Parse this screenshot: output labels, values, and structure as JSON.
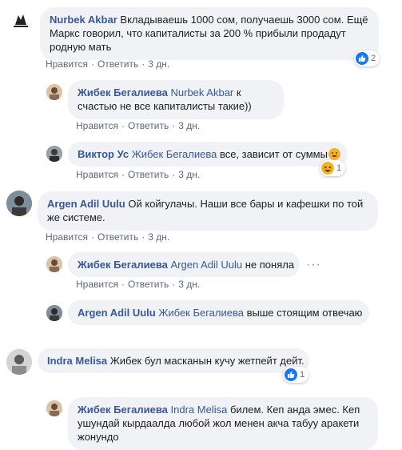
{
  "colors": {
    "author": "#385898",
    "bubble": "#f0f2f5",
    "meta": "#606770",
    "like_blue": "#1877f2",
    "haha_yellow": "#f7b125"
  },
  "labels": {
    "like": "Нравится",
    "reply": "Ответить",
    "sep": "·"
  },
  "comments": [
    {
      "author": "Nurbek Akbar",
      "text": "Вкладываешь 1000 сом, получаешь 3000 сом. Ещё Маркс говорил, что капиталисты за 200 % прибыли продадут родную мать",
      "time": "3 дн.",
      "reactions": {
        "icon": "like-icon",
        "count": "2"
      }
    },
    {
      "author": "Жибек Бегалиева",
      "mention": "Nurbek Akbar",
      "text": "к счастью не все капиталисты такие))",
      "time": "3 дн."
    },
    {
      "author": "Виктор Ус",
      "mention": "Жибек Бегалиева",
      "text": "все, зависит от суммы",
      "emoji": "grinning-sweat-emoji",
      "time": "3 дн.",
      "reactions": {
        "icon": "haha-icon",
        "count": "1"
      }
    },
    {
      "author": "Argen Adil Uulu",
      "text": "Ой койгулачы. Наши все бары и кафешки по той же системе.",
      "time": "3 дн."
    },
    {
      "author": "Жибек Бегалиева",
      "mention": "Argen Adil Uulu",
      "text": "не поняла",
      "time": "3 дн."
    },
    {
      "author": "Argen Adil Uulu",
      "mention": "Жибек Бегалиева",
      "text": "выше стоящим отвечаю"
    },
    {
      "author": "Indra Melisa",
      "text": "Жибек бул масканын кучу жетпейт дейт.",
      "reactions": {
        "icon": "like-icon",
        "count": "1"
      }
    },
    {
      "author": "Жибек Бегалиева",
      "mention": "Indra Melisa",
      "text": "билем. Кеп анда эмес. Кеп ушундай кырдаалда любой жол менен акча табуу аракети жонундо"
    }
  ]
}
